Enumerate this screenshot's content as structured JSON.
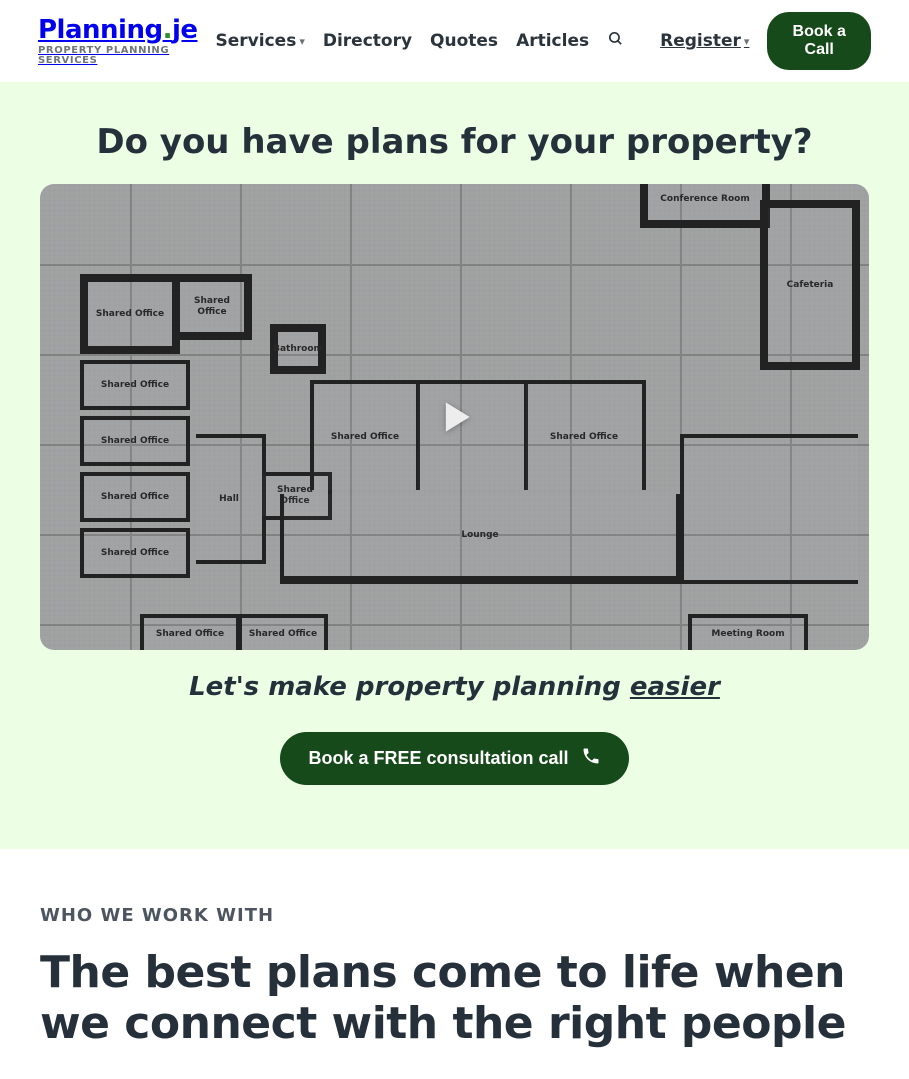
{
  "logo": {
    "brand_pre": "Planning",
    "brand_dot": ".",
    "brand_post": "je",
    "sub": "PROPERTY PLANNING SERVICES"
  },
  "nav": {
    "services": "Services",
    "directory": "Directory",
    "quotes": "Quotes",
    "articles": "Articles"
  },
  "header": {
    "register": "Register",
    "cta": "Book a Call"
  },
  "hero": {
    "heading": "Do you have plans for your property?",
    "tagline_pre": "Let's make property planning ",
    "tagline_em": "easier",
    "cta": "Book a FREE consultation call",
    "rooms": {
      "shared1": "Shared Office",
      "shared2": "Shared Office",
      "shared3": "Shared Office",
      "shared4": "Shared Office",
      "shared5": "Shared Office",
      "shared6": "Shared Office",
      "shared7": "Shared Office",
      "shared8": "Shared Office",
      "shared9": "Shared Office",
      "shared10": "Shared Office",
      "shared11": "Shared Office",
      "bath": "Bathroom",
      "hall": "Hall",
      "lounge": "Lounge",
      "conf": "Conference Room",
      "cafe": "Cafeteria",
      "meeting": "Meeting Room"
    }
  },
  "section": {
    "eyebrow": "WHO WE WORK WITH",
    "heading": "The best plans come to life when we connect with the right people"
  }
}
